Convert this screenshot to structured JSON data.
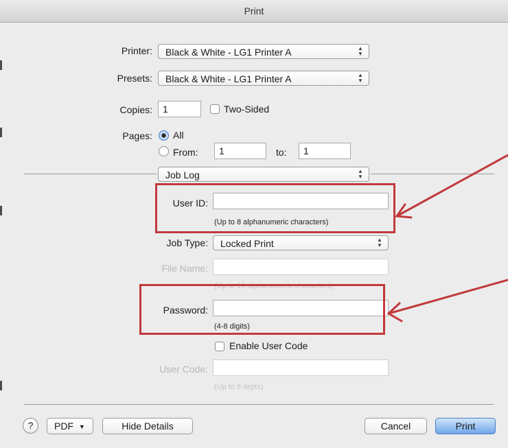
{
  "window": {
    "title": "Print"
  },
  "printer": {
    "label": "Printer:",
    "value": "Black & White - LG1 Printer A"
  },
  "presets": {
    "label": "Presets:",
    "value": "Black & White - LG1 Printer A"
  },
  "copies": {
    "label": "Copies:",
    "value": "1",
    "two_sided_label": "Two-Sided",
    "two_sided_checked": false
  },
  "pages": {
    "label": "Pages:",
    "all_label": "All",
    "from_label": "From:",
    "from_value": "1",
    "to_label": "to:",
    "to_value": "1",
    "selected": "All"
  },
  "section_popup": {
    "value": "Job Log"
  },
  "job_log": {
    "user_id": {
      "label": "User ID:",
      "value": "",
      "hint": "(Up to 8 alphanumeric characters)"
    },
    "job_type": {
      "label": "Job Type:",
      "value": "Locked Print"
    },
    "file_name": {
      "label": "File Name:",
      "value": "",
      "hint": "(Up to 16 alphanumeric characters)",
      "enabled": false
    },
    "password": {
      "label": "Password:",
      "value": "",
      "hint": "(4-8 digits)"
    },
    "enable_user_code": {
      "label": "Enable User Code",
      "checked": false
    },
    "user_code": {
      "label": "User Code:",
      "value": "",
      "hint": "(Up to 8 digits)",
      "enabled": false
    }
  },
  "footer": {
    "help_label": "?",
    "pdf_label": "PDF",
    "hide_details_label": "Hide Details",
    "cancel_label": "Cancel",
    "print_label": "Print"
  },
  "annotations": {
    "highlight_color": "#c1393b"
  },
  "icons": {
    "popup_arrows": "updown-chevron-icon",
    "pdf_menu": "triangle-down-icon",
    "radio_selected": "radio-dot-icon"
  }
}
